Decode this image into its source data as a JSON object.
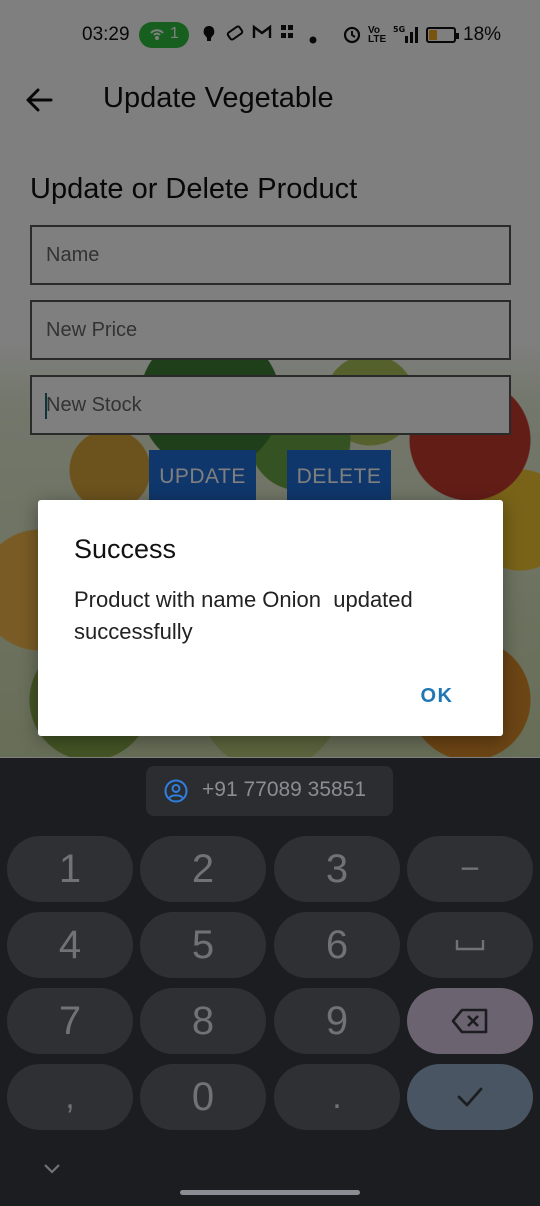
{
  "status_bar": {
    "time": "03:29",
    "hotspot_count": "1",
    "icons": [
      "hotspot-icon",
      "notification-icon",
      "ticket-icon",
      "gmail-icon",
      "grid-icon",
      "dot-icon",
      "alarm-icon",
      "volte-icon",
      "signal-5g-icon",
      "battery-icon"
    ],
    "battery_percent": "18%"
  },
  "app_bar": {
    "back_icon": "arrow-left-icon",
    "title": "Update Vegetable"
  },
  "form": {
    "heading": "Update or Delete Product",
    "name_placeholder": "Name",
    "price_placeholder": "New Price",
    "stock_placeholder": "New Stock",
    "update_label": "UPDATE",
    "delete_label": "DELETE"
  },
  "dialog": {
    "title": "Success",
    "message": "Product with name Onion  updated successfully",
    "ok_label": "OK"
  },
  "keyboard": {
    "suggestion": "+91 77089 35851",
    "keys": [
      "1",
      "2",
      "3",
      "−",
      "4",
      "5",
      "6",
      "␣",
      "7",
      "8",
      "9",
      "⌫",
      ",",
      "0",
      ".",
      "✓"
    ]
  },
  "colors": {
    "accent_button": "#1e6fd6",
    "dialog_ok": "#1f78b4",
    "hotspot_pill": "#2fbf3f",
    "keyboard_bg": "#1c1d20"
  }
}
